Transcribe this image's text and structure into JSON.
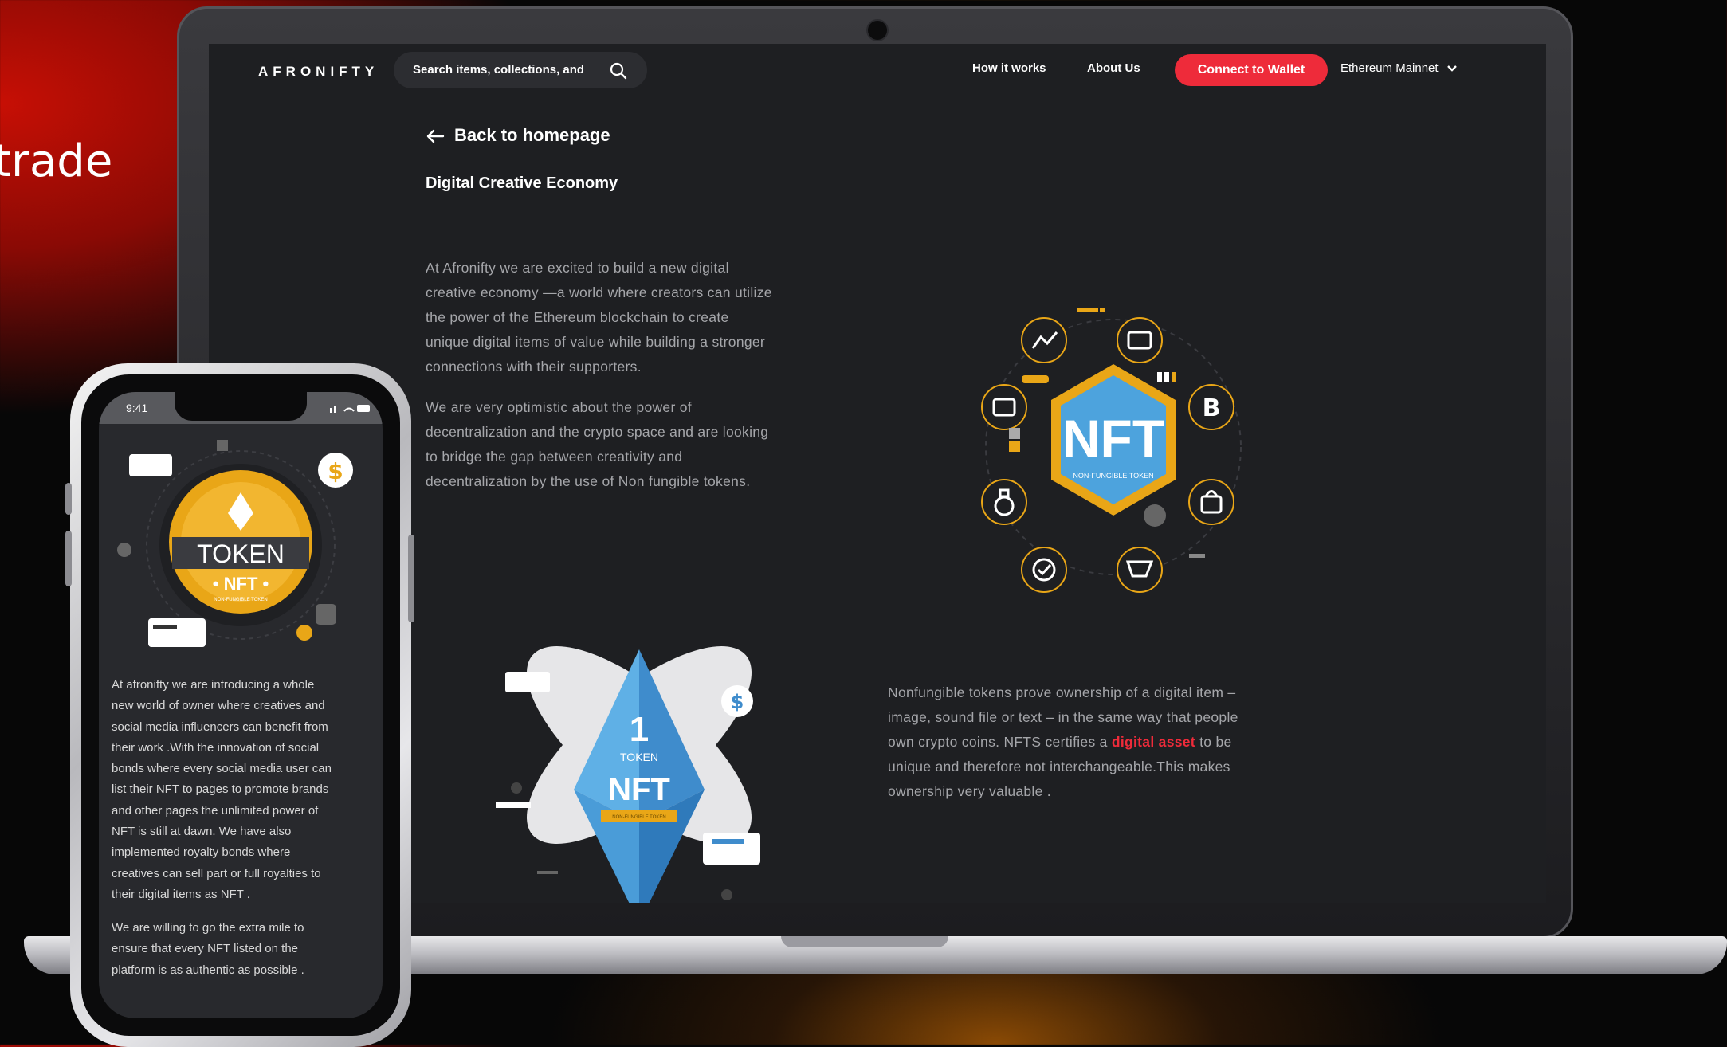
{
  "background": {
    "partial_text": "trade",
    "colors": {
      "accent_red": "#c70f05",
      "accent_orange": "#8a4a05"
    }
  },
  "laptop": {
    "nav": {
      "logo": "AFRONIFTY",
      "search_placeholder": "Search items, collections, and",
      "links": [
        "How it works",
        "About Us"
      ],
      "connect_label": "Connect to Wallet",
      "network_label": "Ethereum Mainnet"
    },
    "back_label": "Back to homepage",
    "section_title": "Digital Creative Economy",
    "para1_lines": [
      "At Afronifty we are excited to build a new digital",
      "creative economy —a world where creators can utilize",
      "the power of the Ethereum blockchain to create",
      "unique digital items of value while building a stronger",
      "connections with their supporters."
    ],
    "para2_lines": [
      "We are very optimistic about the power of",
      "decentralization and the crypto space and are looking",
      "to bridge the gap between creativity and",
      "decentralization by the use of Non fungible tokens."
    ],
    "para3": {
      "line1": "Nonfungible tokens prove ownership of a digital item –",
      "line2": "image, sound file or text – in the same way that people",
      "line3_before": "own crypto coins. NFTS certifies a ",
      "line3_link": "digital asset",
      "line3_after": " to be",
      "line4": "unique and therefore not interchangeable.This makes",
      "line5": "ownership very valuable ."
    },
    "illus1": {
      "main": "NFT",
      "sub": "NON-FUNGIBLE TOKEN"
    },
    "illus2": {
      "num": "1",
      "token": "TOKEN",
      "nft": "NFT",
      "strip": "NON-FUNGIBLE TOKEN",
      "dollar": "$"
    },
    "colors": {
      "connect": "#ee2b3a",
      "screen_bg": "#1e1f22",
      "gold": "#e9a617",
      "blue": "#4da3dd"
    }
  },
  "phone": {
    "time": "9:41",
    "coin": {
      "token": "TOKEN",
      "nft": "• NFT •",
      "sub": "NON-FUNGIBLE TOKEN",
      "dollar": "$"
    },
    "para1_lines": [
      "At afronifty we are introducing a whole",
      "new world of owner where creatives and",
      "social media influencers can benefit from",
      "their work .With the innovation of social",
      "bonds where every social media user can",
      "list their NFT to pages to promote brands",
      "and other pages the unlimited power of",
      "NFT is still at dawn. We have also",
      "implemented royalty bonds where",
      "creatives can sell part or full royalties to",
      "their digital items as NFT ."
    ],
    "para2_lines": [
      "We are willing to go the extra mile to",
      "ensure that every NFT listed on the",
      "platform is as authentic as possible ."
    ]
  }
}
